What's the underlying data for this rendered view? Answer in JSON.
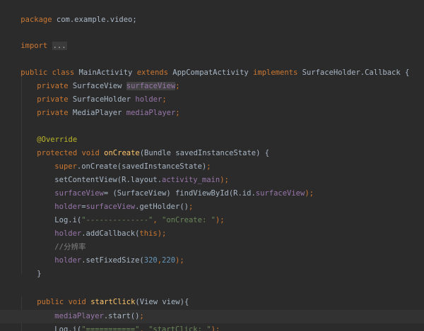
{
  "colors": {
    "background": "#2b2b2b",
    "keyword": "#cc7832",
    "field": "#9876aa",
    "method_declaration": "#ffc66d",
    "string": "#6a8759",
    "number": "#6897bb",
    "annotation": "#bbb529",
    "comment": "#808080",
    "plain": "#a9b7c6"
  },
  "code": {
    "package_kw": "package",
    "package_name": " com.example.video;",
    "import_kw": "import",
    "import_folded": "...",
    "class_line": {
      "public": "public",
      "class": "class",
      "name": " MainActivity ",
      "extends": "extends",
      "super": " AppCompatActivity ",
      "implements": "implements",
      "iface": " SurfaceHolder.Callback {"
    },
    "fields": [
      {
        "mod": "private",
        "type": " SurfaceView ",
        "name": "surfaceView",
        "end": ";"
      },
      {
        "mod": "private",
        "type": " SurfaceHolder ",
        "name": "holder",
        "end": ";"
      },
      {
        "mod": "private",
        "type": " MediaPlayer ",
        "name": "mediaPlayer",
        "end": ";"
      }
    ],
    "annotation": "@Override",
    "oncreate_sig": {
      "protected": "protected",
      "void": "void",
      "name": "onCreate",
      "params": "(Bundle savedInstanceState) {"
    },
    "oncreate_body": {
      "super_kw": "super",
      "super_rest": ".onCreate(savedInstanceState)",
      "semi": ";",
      "setcontent": "setContentView(R.layout.",
      "layout_field": "activity_main",
      "setcontent_end": ");",
      "sv_field": "surfaceView",
      "sv_assign": "= (SurfaceView) findViewById(R.id.",
      "sv_id": "surfaceView",
      "sv_end": ");",
      "holder_field": "holder",
      "holder_assign": "=",
      "holder_sv": "surfaceView",
      "holder_rest": ".getHolder()",
      "log_prefix": "Log.i(",
      "log_tag": "\"--------------\"",
      "log_comma": ", ",
      "log_msg": "\"onCreate: \"",
      "log_end": ");",
      "addcb_field": "holder",
      "addcb_rest": ".addCallback(",
      "this_kw": "this",
      "addcb_end": ");",
      "comment": "//分辨率",
      "fixed_field": "holder",
      "fixed_rest": ".setFixedSize(",
      "num1": "320",
      "num_comma": ",",
      "num2": "220",
      "fixed_end": ");",
      "close_brace": "}"
    },
    "startclick_sig": {
      "public": "public",
      "void": "void",
      "name": "startClick",
      "params": "(View view){"
    },
    "startclick_body": {
      "mp_field": "mediaPlayer",
      "mp_rest": ".start()",
      "log_prefix": "Log.i(",
      "log_tag": "\"===========\"",
      "log_comma": ", ",
      "log_msg": "\"startClick: \"",
      "log_end": ");"
    }
  }
}
